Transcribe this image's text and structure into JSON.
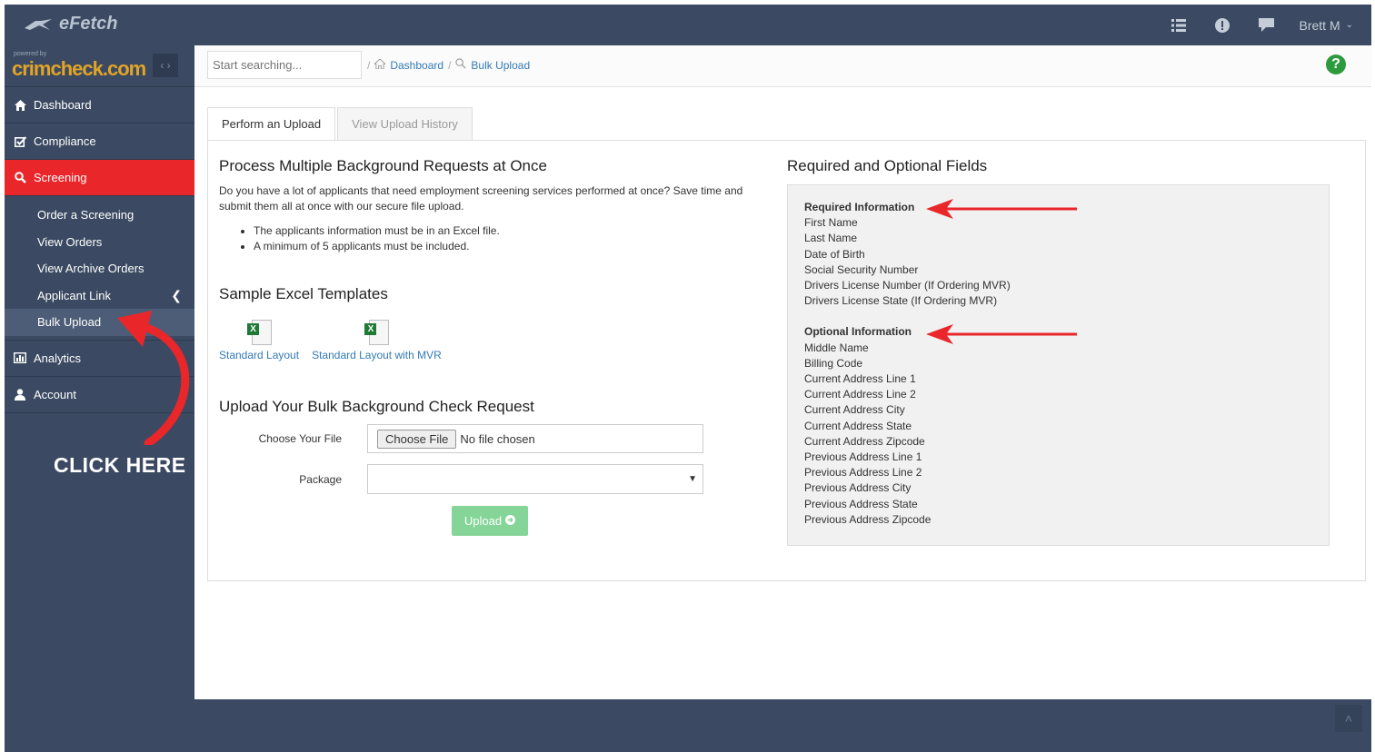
{
  "app": {
    "name": "eFetch",
    "brand_small": "powered by",
    "brand": "crimcheck.com"
  },
  "topbar": {
    "user": "Brett M"
  },
  "sidebar": {
    "items": [
      {
        "label": "Dashboard",
        "icon": "home-icon"
      },
      {
        "label": "Compliance",
        "icon": "check-square-icon"
      },
      {
        "label": "Screening",
        "icon": "search-icon"
      },
      {
        "label": "Analytics",
        "icon": "bar-chart-icon"
      },
      {
        "label": "Account",
        "icon": "user-icon"
      }
    ],
    "screening_sub": [
      {
        "label": "Order a Screening"
      },
      {
        "label": "View Orders"
      },
      {
        "label": "View Archive Orders"
      },
      {
        "label": "Applicant Link"
      },
      {
        "label": "Bulk Upload"
      }
    ],
    "callout": "CLICK HERE"
  },
  "header": {
    "search_placeholder": "Start searching...",
    "breadcrumb": [
      "Dashboard",
      "Bulk Upload"
    ],
    "separator": "/"
  },
  "tabs": [
    "Perform an Upload",
    "View Upload History"
  ],
  "left": {
    "title": "Process Multiple Background Requests at Once",
    "description": "Do you have a lot of applicants that need employment screening services performed at once? Save time and submit them all at once with our secure file upload.",
    "bullets": [
      "The applicants information must be in an Excel file.",
      "A minimum of 5 applicants must be included."
    ],
    "templates_title": "Sample Excel Templates",
    "templates": [
      "Standard Layout",
      "Standard Layout with MVR"
    ],
    "upload_title": "Upload Your Bulk Background Check Request",
    "file_label": "Choose Your File",
    "file_button": "Choose File",
    "file_status": "No file chosen",
    "package_label": "Package",
    "select_arrow": "▼",
    "upload_button": "Upload"
  },
  "right": {
    "title": "Required and Optional Fields",
    "required_title": "Required Information",
    "required": [
      "First Name",
      "Last Name",
      "Date of Birth",
      "Social Security Number",
      "Drivers License Number (If Ordering MVR)",
      "Drivers License State (If Ordering MVR)"
    ],
    "optional_title": "Optional Information",
    "optional": [
      "Middle Name",
      "Billing Code",
      "Current Address Line 1",
      "Current Address Line 2",
      "Current Address City",
      "Current Address State",
      "Current Address Zipcode",
      "Previous Address Line 1",
      "Previous Address Line 2",
      "Previous Address City",
      "Previous Address State",
      "Previous Address Zipcode"
    ]
  },
  "colors": {
    "sidebar": "#3b4a62",
    "active": "#e9262a",
    "link": "#337ab7",
    "upload": "#86d598",
    "help": "#2e9a3e"
  }
}
